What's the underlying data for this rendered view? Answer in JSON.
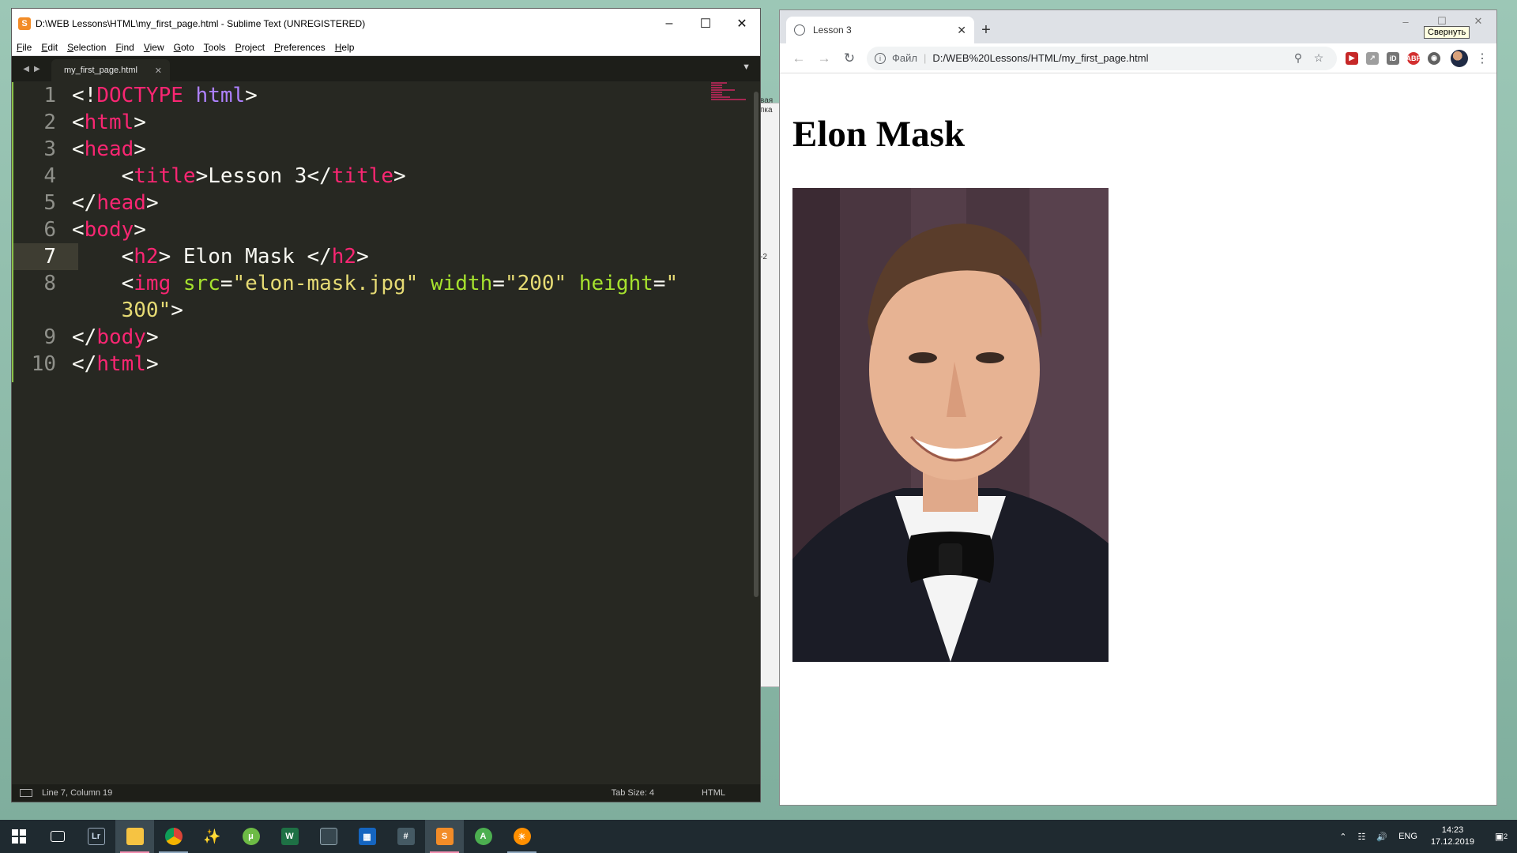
{
  "sublime": {
    "title": "D:\\WEB Lessons\\HTML\\my_first_page.html - Sublime Text (UNREGISTERED)",
    "menu": [
      "File",
      "Edit",
      "Selection",
      "Find",
      "View",
      "Goto",
      "Tools",
      "Project",
      "Preferences",
      "Help"
    ],
    "tab_label": "my_first_page.html",
    "line_numbers": [
      "1",
      "2",
      "3",
      "4",
      "5",
      "6",
      "7",
      "8",
      "9",
      "10"
    ],
    "active_line": "7",
    "status_position": "Line 7, Column 19",
    "status_tab_size": "Tab Size: 4",
    "status_syntax": "HTML",
    "colors": {
      "tag": "#f92672",
      "attr": "#a6e22e",
      "string": "#e6db74",
      "doctype": "#ae81ff",
      "bg": "#272822"
    }
  },
  "code": {
    "l1_doctype": "DOCTYPE",
    "l1_html": "html",
    "html_tag": "html",
    "head_tag": "head",
    "title_tag": "title",
    "title_text": "Lesson 3",
    "body_tag": "body",
    "h2_tag": "h2",
    "h2_text": " Elon Mask ",
    "img_tag": "img",
    "src_attr": "src",
    "src_val": "\"elon-mask.jpg\"",
    "width_attr": "width",
    "width_val": "\"200\"",
    "height_attr": "height",
    "height_val_a": "\"",
    "height_val_b": "300\""
  },
  "chrome": {
    "tab_title": "Lesson 3",
    "tooltip": "Свернуть",
    "url_scheme": "Файл",
    "url": "D:/WEB%20Lessons/HTML/my_first_page.html",
    "page_heading": "Elon Mask",
    "extensions": [
      "ext-red",
      "ext-gray",
      "ext-id",
      "ABP",
      "ext-globe"
    ]
  },
  "desktop": {
    "bg_text_1": "вая",
    "bg_text_2": "пка",
    "bg_text_3": "-2"
  },
  "taskbar": {
    "pinned": [
      "task-view",
      "lightroom",
      "file-explorer",
      "chrome",
      "audition",
      "utorrent",
      "excel-like",
      "tv",
      "video-editor",
      "calculator",
      "sublime",
      "android-studio",
      "grill-app"
    ],
    "lang": "ENG",
    "time": "14:23",
    "date": "17.12.2019",
    "notifications": "2"
  }
}
